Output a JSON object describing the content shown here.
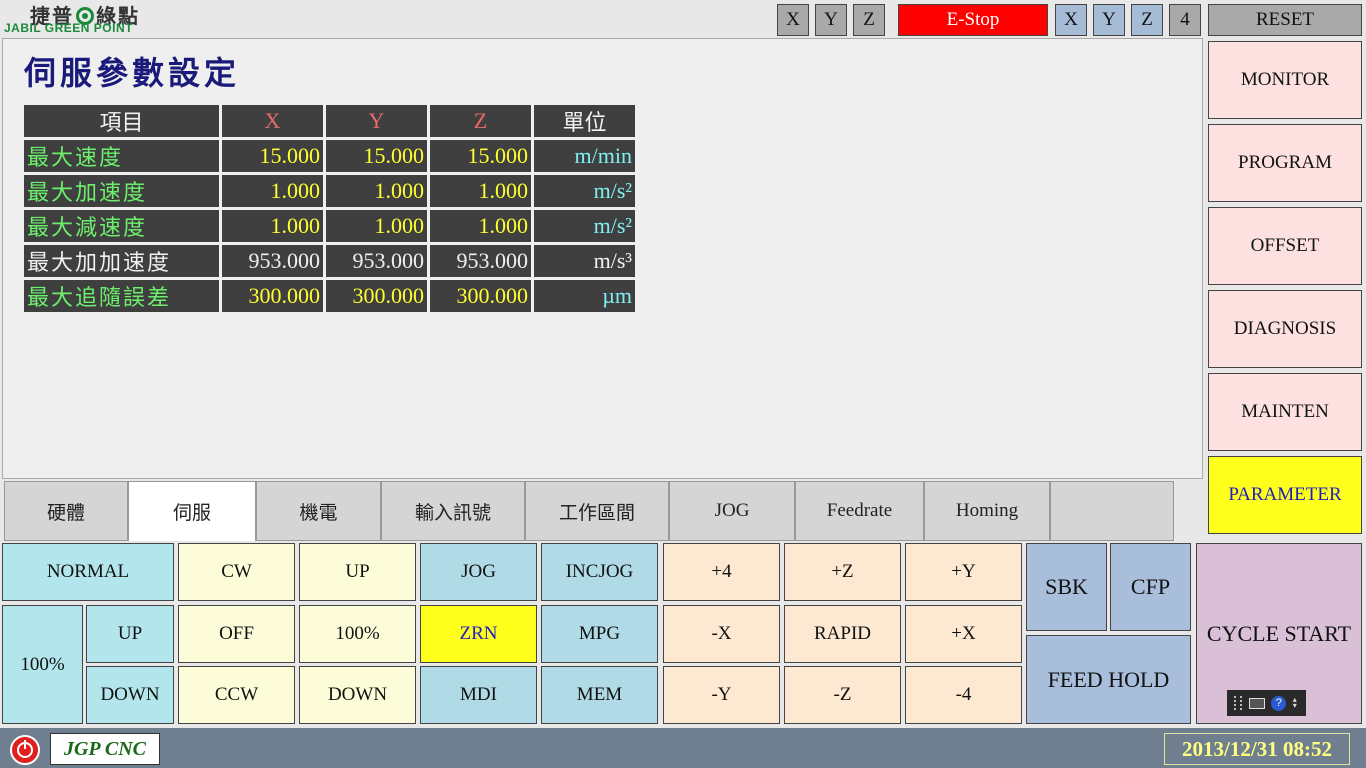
{
  "header": {
    "logo_cn_left": "捷普",
    "logo_cn_right": "綠點",
    "logo_en": "JABIL GREEN POINT",
    "axis_left": [
      "X",
      "Y",
      "Z"
    ],
    "estop_label": "E-Stop",
    "axis_right": [
      "X",
      "Y",
      "Z",
      "4"
    ],
    "reset_label": "RESET"
  },
  "page": {
    "title": "伺服參數設定"
  },
  "table": {
    "headers": [
      "項目",
      "X",
      "Y",
      "Z",
      "單位"
    ],
    "rows": [
      {
        "name": "最大速度",
        "x": "15.000",
        "y": "15.000",
        "z": "15.000",
        "unit": "m/min"
      },
      {
        "name": "最大加速度",
        "x": "1.000",
        "y": "1.000",
        "z": "1.000",
        "unit": "m/s²"
      },
      {
        "name": "最大減速度",
        "x": "1.000",
        "y": "1.000",
        "z": "1.000",
        "unit": "m/s²"
      },
      {
        "name": "最大加加速度",
        "x": "953.000",
        "y": "953.000",
        "z": "953.000",
        "unit": "m/s³"
      },
      {
        "name": "最大追隨誤差",
        "x": "300.000",
        "y": "300.000",
        "z": "300.000",
        "unit": "µm"
      }
    ]
  },
  "tabs": [
    "硬體",
    "伺服",
    "機電",
    "輸入訊號",
    "工作區間",
    "JOG",
    "Feedrate",
    "Homing",
    ""
  ],
  "active_tab": "伺服",
  "side_menu": [
    "MONITOR",
    "PROGRAM",
    "OFFSET",
    "DIAGNOSIS",
    "MAINTEN",
    "PARAMETER"
  ],
  "active_side": "PARAMETER",
  "controls": {
    "normal": "NORMAL",
    "pct_left": "100%",
    "up_left": "UP",
    "down_left": "DOWN",
    "cw": "CW",
    "off": "OFF",
    "ccw": "CCW",
    "up_mid": "UP",
    "pct_mid": "100%",
    "down_mid": "DOWN",
    "jog": "JOG",
    "zrn": "ZRN",
    "mdi": "MDI",
    "incjog": "INCJOG",
    "mpg": "MPG",
    "mem": "MEM",
    "plus4": "+4",
    "minus_x": "-X",
    "minus_y": "-Y",
    "plus_z": "+Z",
    "rapid": "RAPID",
    "minus_z": "-Z",
    "plus_y": "+Y",
    "plus_x": "+X",
    "minus4": "-4",
    "sbk": "SBK",
    "cfp": "CFP",
    "feed_hold": "FEED HOLD",
    "cycle_start": "CYCLE START"
  },
  "status": {
    "brand": "JGP CNC",
    "datetime": "2013/12/31 08:52"
  },
  "colors": {
    "estop": "#ff0000",
    "active_yellow": "#ffff1c",
    "title_blue": "#1a1a7a"
  }
}
